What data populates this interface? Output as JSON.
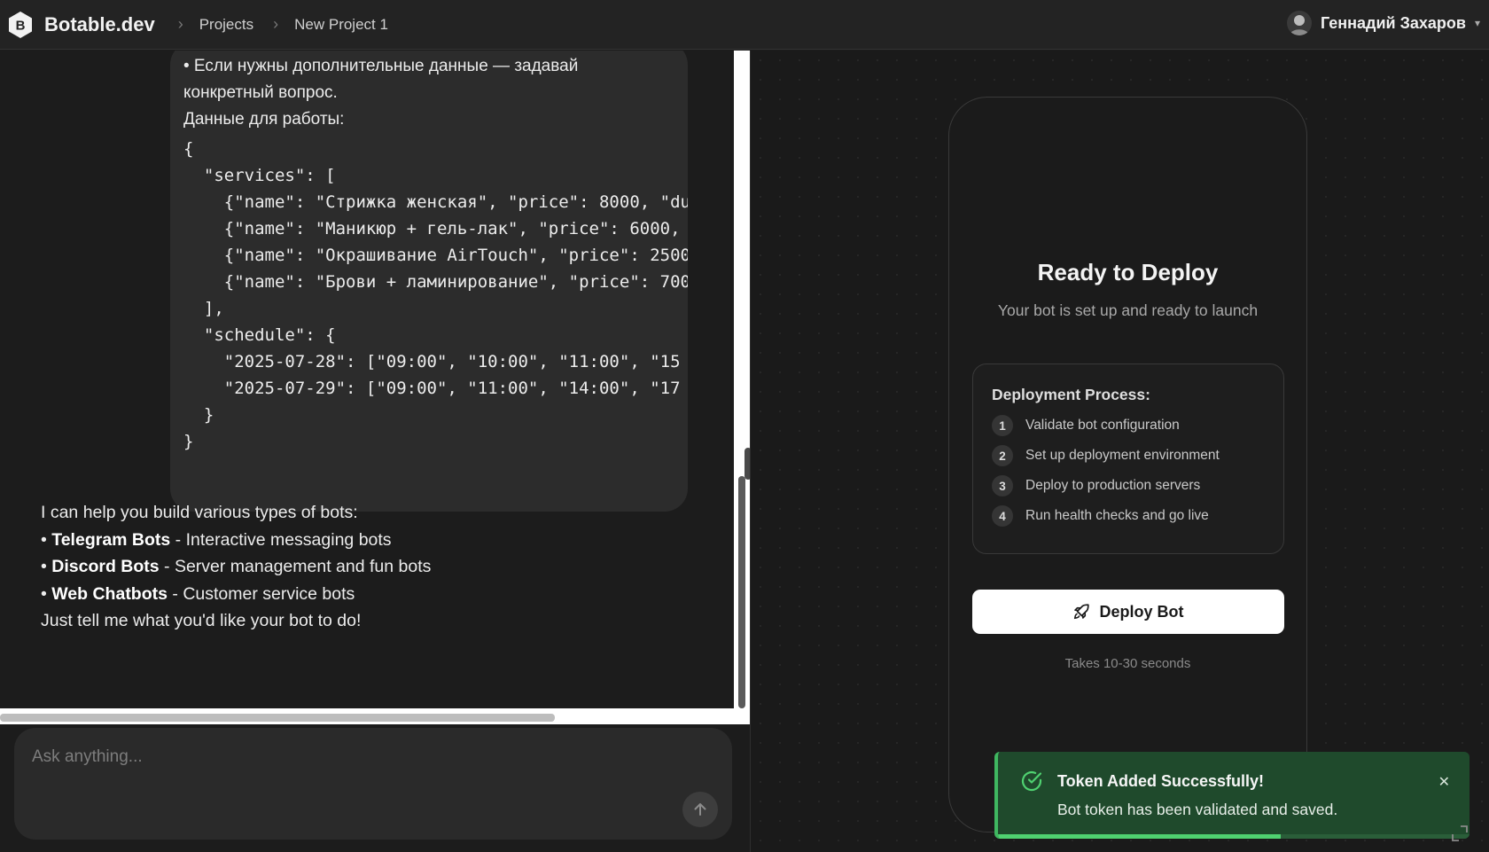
{
  "header": {
    "brand": "Botable.dev",
    "breadcrumbs": [
      "Projects",
      "New Project 1"
    ],
    "user_name": "Геннадий Захаров"
  },
  "chat": {
    "user_message_lines": [
      "• Если нужны дополнительные данные — задавай",
      "конкретный вопрос.",
      "Данные для работы:"
    ],
    "code_lines": [
      "{",
      "  \"services\": [",
      "    {\"name\": \"Стрижка женская\", \"price\": 8000, \"du",
      "    {\"name\": \"Маникюр + гель-лак\", \"price\": 6000,",
      "    {\"name\": \"Окрашивание AirTouch\", \"price\": 2500",
      "    {\"name\": \"Брови + ламинирование\", \"price\": 700",
      "  ],",
      "  \"schedule\": {",
      "    \"2025-07-28\": [\"09:00\", \"10:00\", \"11:00\", \"15",
      "    \"2025-07-29\": [\"09:00\", \"11:00\", \"14:00\", \"17",
      "  }",
      "}"
    ],
    "assistant": {
      "intro": "I can help you build various types of bots:",
      "items": [
        {
          "bullet": "• ",
          "name": "Telegram Bots",
          "desc": " - Interactive messaging bots"
        },
        {
          "bullet": "• ",
          "name": "Discord Bots",
          "desc": " - Server management and fun bots"
        },
        {
          "bullet": "• ",
          "name": "Web Chatbots",
          "desc": " - Customer service bots"
        }
      ],
      "outro": "Just tell me what you'd like your bot to do!"
    },
    "composer_placeholder": "Ask anything..."
  },
  "preview": {
    "title": "Ready to Deploy",
    "subtitle": "Your bot is set up and ready to launch",
    "process_title": "Deployment Process:",
    "steps": [
      {
        "num": "1",
        "label": "Validate bot configuration"
      },
      {
        "num": "2",
        "label": "Set up deployment environment"
      },
      {
        "num": "3",
        "label": "Deploy to production servers"
      },
      {
        "num": "4",
        "label": "Run health checks and go live"
      }
    ],
    "deploy_button": "Deploy Bot",
    "deploy_note": "Takes 10-30 seconds"
  },
  "toast": {
    "title": "Token Added Successfully!",
    "message": "Bot token has been validated and saved.",
    "progress": 0.6
  },
  "colors": {
    "accent_success": "#3fb760",
    "toast_bg": "#1f4a2c"
  }
}
